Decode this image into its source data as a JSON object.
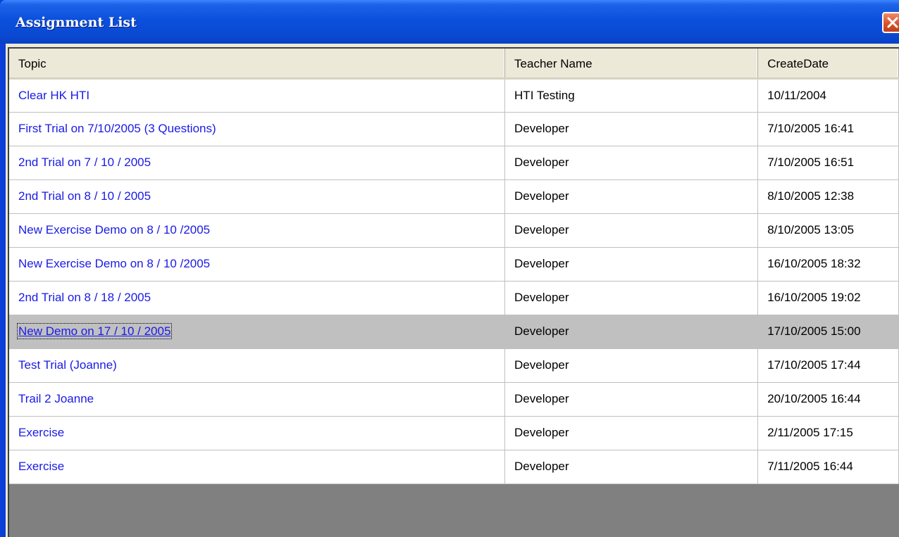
{
  "window": {
    "title": "Assignment List"
  },
  "table": {
    "headers": [
      "Topic",
      "Teacher Name",
      "CreateDate"
    ],
    "rows": [
      {
        "topic": "Clear HK HTI",
        "teacher": "HTI Testing",
        "date": "10/11/2004"
      },
      {
        "topic": "First Trial on 7/10/2005 (3 Questions)",
        "teacher": "Developer",
        "date": "7/10/2005 16:41"
      },
      {
        "topic": "2nd Trial on 7 / 10 / 2005",
        "teacher": "Developer",
        "date": "7/10/2005 16:51"
      },
      {
        "topic": "2nd Trial on 8 / 10 / 2005",
        "teacher": "Developer",
        "date": "8/10/2005 12:38"
      },
      {
        "topic": "New Exercise Demo on 8 / 10 /2005",
        "teacher": "Developer",
        "date": "8/10/2005 13:05"
      },
      {
        "topic": "New Exercise Demo on 8 / 10 /2005",
        "teacher": "Developer",
        "date": "16/10/2005 18:32"
      },
      {
        "topic": "2nd Trial on 8 / 18 / 2005",
        "teacher": "Developer",
        "date": "16/10/2005 19:02"
      },
      {
        "topic": "New Demo on 17 / 10 / 2005",
        "teacher": "Developer",
        "date": "17/10/2005 15:00",
        "selected": true
      },
      {
        "topic": "Test Trial (Joanne)",
        "teacher": "Developer",
        "date": "17/10/2005 17:44"
      },
      {
        "topic": "Trail 2 Joanne",
        "teacher": "Developer",
        "date": "20/10/2005 16:44"
      },
      {
        "topic": "Exercise",
        "teacher": "Developer",
        "date": "2/11/2005 17:15"
      },
      {
        "topic": "Exercise",
        "teacher": "Developer",
        "date": "7/11/2005 16:44"
      }
    ]
  },
  "colors": {
    "link": "#1a1ae6",
    "selected_row": "#c0c0c0",
    "grid_background": "#808080",
    "titlebar": "#0a50dc"
  },
  "icons": {
    "close": "close-icon"
  }
}
